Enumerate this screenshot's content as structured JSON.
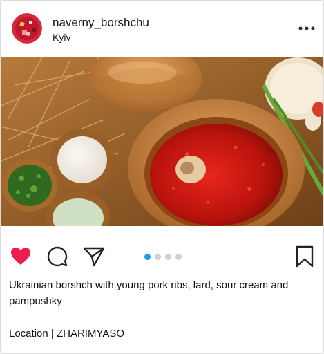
{
  "post": {
    "username": "naverny_borshchu",
    "location": "Kyiv",
    "caption": "Ukrainian borshch with young pork ribs, lard, sour cream and pampushky",
    "location_line": "Location | ZHARIMYASO"
  },
  "header": {
    "more_icon": "more-horizontal-icon"
  },
  "actions": {
    "like_icon": "heart-filled-icon",
    "comment_icon": "comment-bubble-icon",
    "share_icon": "paper-plane-icon",
    "save_icon": "bookmark-icon",
    "liked": true
  },
  "carousel": {
    "total": 4,
    "current": 1
  },
  "colors": {
    "like": "#ee1d4d",
    "active_dot": "#1d9bf0",
    "inactive_dot": "#cfcfcf"
  }
}
